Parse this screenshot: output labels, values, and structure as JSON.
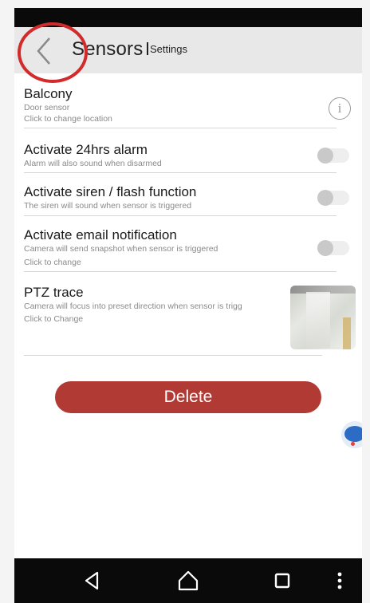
{
  "header": {
    "title": "Sensors",
    "subtitle": "Settings"
  },
  "items": {
    "location": {
      "title": "Balcony",
      "type": "Door sensor",
      "hint": "Click to change location"
    },
    "alarm24": {
      "title": "Activate 24hrs alarm",
      "desc": "Alarm will also sound when disarmed",
      "enabled": false
    },
    "siren": {
      "title": "Activate siren / flash function",
      "desc": "The siren will sound when sensor is triggered",
      "enabled": false
    },
    "email": {
      "title": "Activate email notification",
      "desc": "Camera will send snapshot when sensor is triggered",
      "hint": "Click to change",
      "enabled": false
    },
    "ptz": {
      "title": "PTZ trace",
      "desc": "Camera will focus into preset direction when sensor is trigg",
      "hint": "Click to Change"
    }
  },
  "actions": {
    "delete_label": "Delete"
  },
  "icons": {
    "back": "chevron-left-icon",
    "info": "info-icon",
    "nav_back": "triangle-back-icon",
    "nav_home": "home-icon",
    "nav_recents": "square-recents-icon",
    "nav_more": "more-vertical-icon"
  },
  "colors": {
    "accent": "#b23a34",
    "annotation": "#d12b2b",
    "header_bg": "#e8e8e8",
    "toggle_off": "#c9c9c9"
  }
}
